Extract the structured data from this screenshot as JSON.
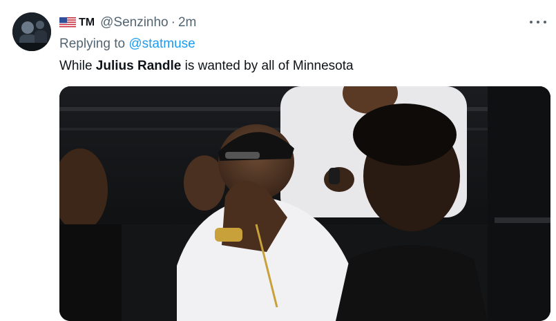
{
  "tweet": {
    "display_name": "TM",
    "handle": "@Senzinho",
    "separator": "·",
    "time": "2m",
    "replying_prefix": "Replying to",
    "replying_to": "@statmuse",
    "text_before": "While ",
    "text_bold": "Julius Randle",
    "text_after": " is wanted by all of Minnesota"
  },
  "icons": {
    "flag": "us-flag-icon",
    "more": "more-options-icon"
  },
  "colors": {
    "text": "#0f1419",
    "secondary": "#536471",
    "link": "#1d9bf0"
  }
}
